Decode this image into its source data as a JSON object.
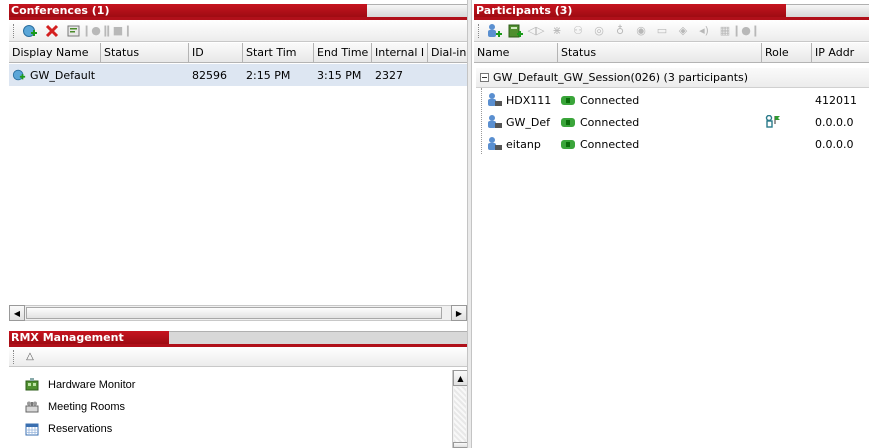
{
  "conferences": {
    "title": "Conferences (1)",
    "columns": [
      "Display Name",
      "Status",
      "ID",
      "Start Tim",
      "End Time",
      "Internal I",
      "Dial-in"
    ],
    "rows": [
      {
        "display_name": "GW_Default",
        "status": "",
        "id": "82596",
        "start": "2:15 PM",
        "end": "3:15 PM",
        "internal": "2327",
        "dialin": ""
      }
    ],
    "toolbar_icons": [
      "add-conference-icon",
      "delete-conference-icon",
      "conference-properties-icon",
      "disabled-action-icon",
      "disabled-action-icon"
    ]
  },
  "participants": {
    "title": "Participants (3)",
    "columns": [
      "Name",
      "Status",
      "Role",
      "IP Addr"
    ],
    "group_label": "GW_Default_GW_Session(026) (3 participants)",
    "rows": [
      {
        "name": "HDX111",
        "status": "Connected",
        "role_icon": "",
        "ip": "412011"
      },
      {
        "name": "GW_Def",
        "status": "Connected",
        "role_icon": "gateway-role-icon",
        "ip": "0.0.0.0"
      },
      {
        "name": "eitanp",
        "status": "Connected",
        "role_icon": "",
        "ip": "0.0.0.0"
      }
    ]
  },
  "management": {
    "title": "RMX Management",
    "items": [
      "Hardware Monitor",
      "Meeting Rooms",
      "Reservations"
    ]
  },
  "colors": {
    "title_red": "#b0101a",
    "selection": "#dde6f2",
    "connected_green": "#3aa53a"
  }
}
